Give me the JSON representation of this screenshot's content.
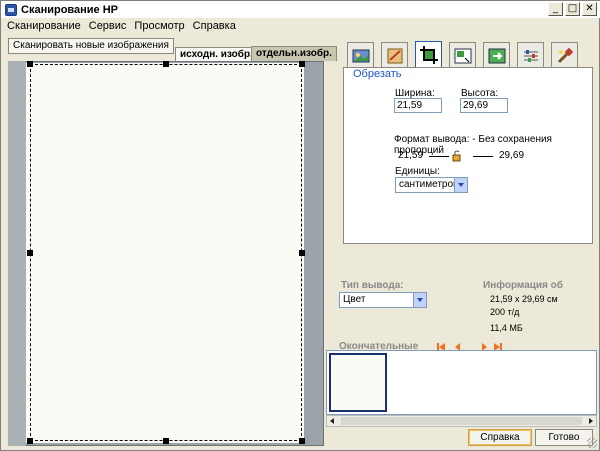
{
  "window": {
    "title": "Сканирование HP",
    "controls": {
      "minimize": "_",
      "maximize": "□",
      "close": "✕"
    }
  },
  "menu": {
    "items": [
      "Сканирование",
      "Сервис",
      "Просмотр",
      "Справка"
    ]
  },
  "preview": {
    "scan_new_label": "Сканировать новые изображения",
    "tabs": [
      "исходн. изобр.",
      "отдельн.изобр."
    ]
  },
  "tools": {
    "tabs": [
      {
        "icon": "image-type-icon"
      },
      {
        "icon": "adjust-image-icon"
      },
      {
        "icon": "crop-icon",
        "active": true
      },
      {
        "icon": "resize-icon"
      },
      {
        "icon": "color-icon"
      },
      {
        "icon": "tone-sliders-icon"
      },
      {
        "icon": "advanced-tools-icon"
      }
    ]
  },
  "crop": {
    "title": "Обрезать",
    "width_label": "Ширина:",
    "width_value": "21,59",
    "height_label": "Высота:",
    "height_value": "29,69",
    "output_label": "Формат вывода: - Без сохранения пропорций",
    "ratio_left": "21,59",
    "ratio_right": "29,69",
    "units_label": "Единицы:",
    "units_value": "сантиметров"
  },
  "output": {
    "type_label": "Тип вывода:",
    "type_value": "Цвет",
    "info_label": "Информация об",
    "info_size": "21,59 x 29,69 см",
    "info_dpi": "200 т/д",
    "info_filesize": "11,4 МБ"
  },
  "final": {
    "label": "Окончательные"
  },
  "buttons": {
    "help": "Справка",
    "done": "Готово"
  },
  "colors": {
    "accent": "#1f55c4",
    "nav_arrows": "#f07020",
    "selection": "#1c2f70"
  }
}
